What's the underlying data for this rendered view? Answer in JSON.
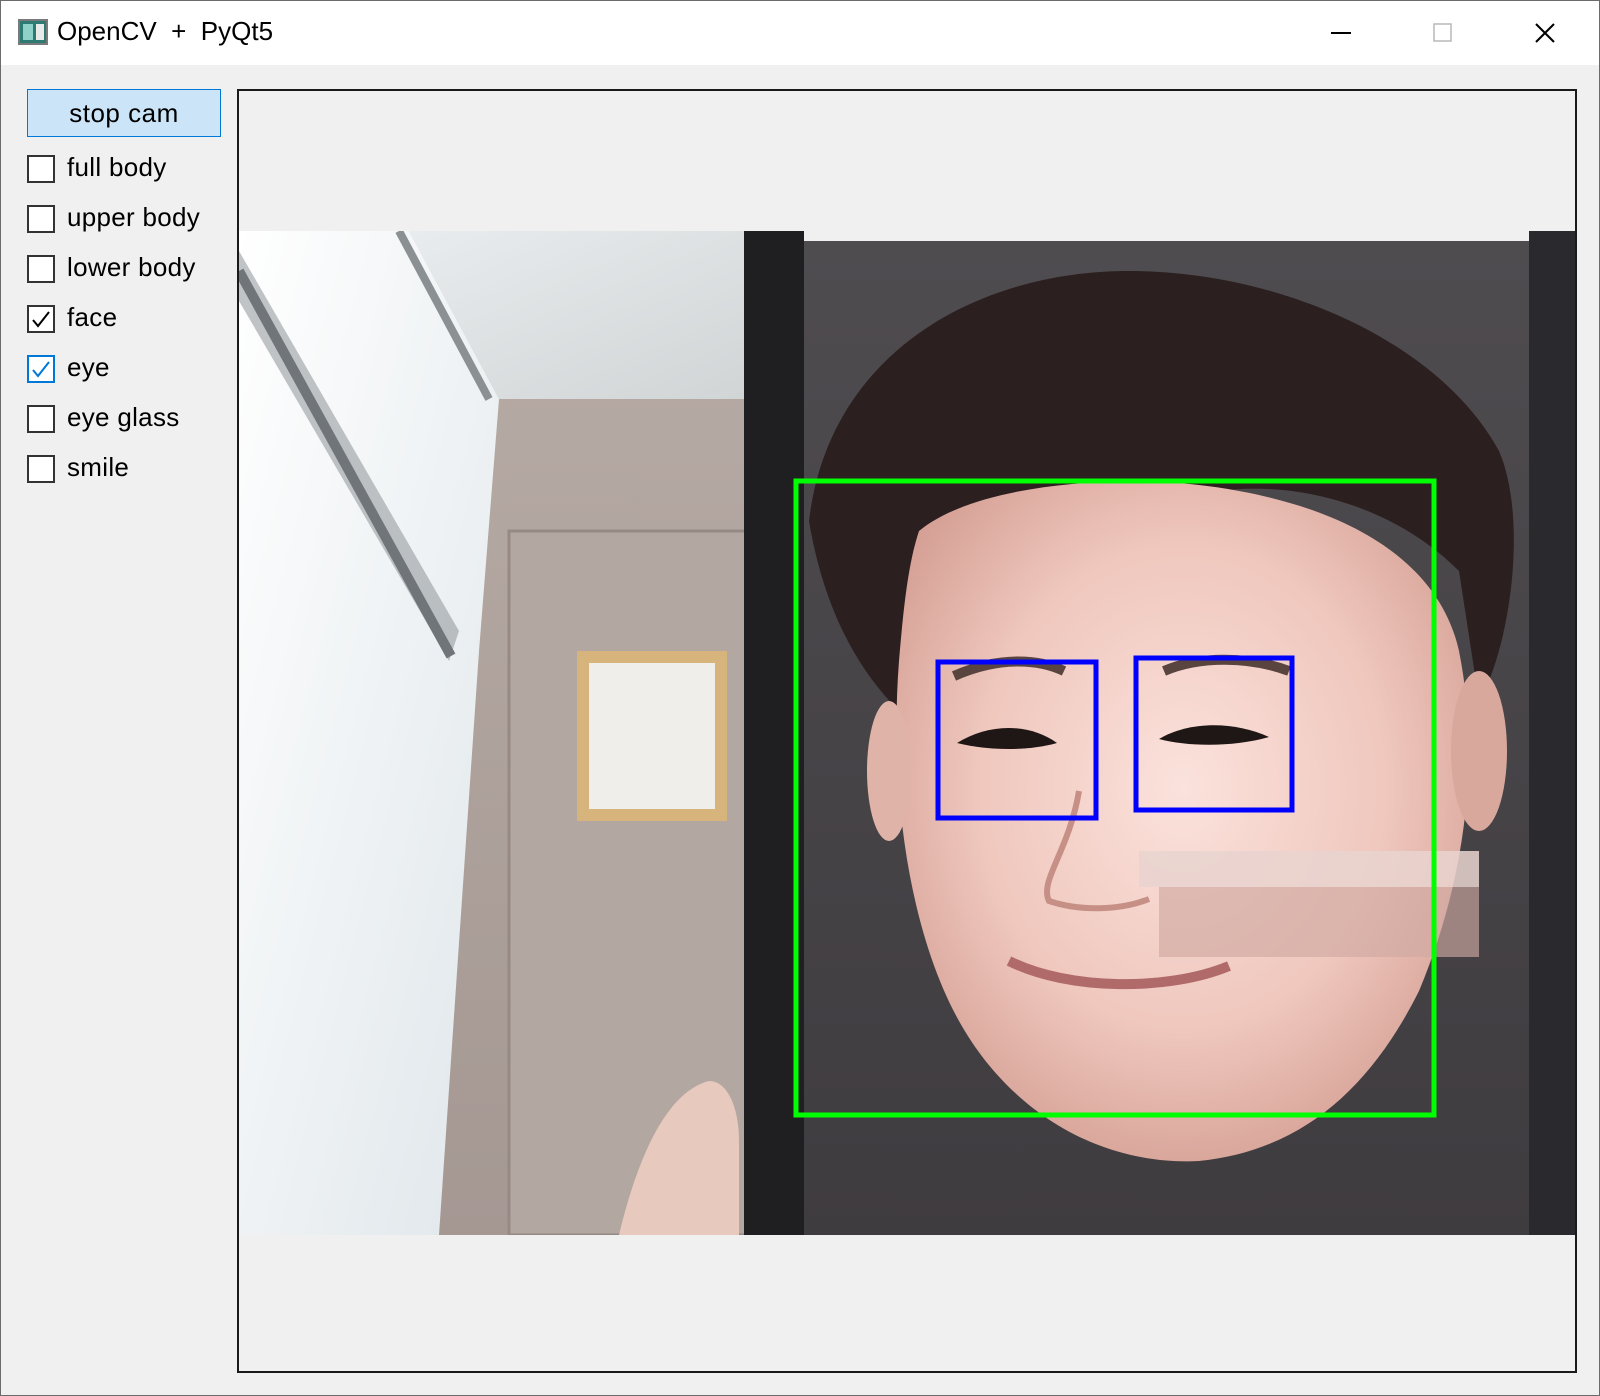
{
  "window": {
    "title": "OpenCV  +  PyQt5",
    "controls": {
      "minimize": "minimize-icon",
      "maximize": "maximize-icon",
      "close": "close-icon"
    }
  },
  "sidebar": {
    "button_label": "stop cam",
    "checkboxes": [
      {
        "label": "full body",
        "checked": false
      },
      {
        "label": "upper body",
        "checked": false
      },
      {
        "label": "lower body",
        "checked": false
      },
      {
        "label": "face",
        "checked": true
      },
      {
        "label": "eye",
        "checked": true
      },
      {
        "label": "eye glass",
        "checked": false
      },
      {
        "label": "smile",
        "checked": false
      }
    ]
  },
  "video": {
    "detections": [
      {
        "type": "face",
        "color": "#00ff00"
      },
      {
        "type": "eye",
        "color": "#0000ff"
      },
      {
        "type": "eye",
        "color": "#0000ff"
      }
    ]
  },
  "colors": {
    "accent": "#0078d7",
    "button_bg": "#cce4f7",
    "window_bg": "#f0f0f0"
  }
}
